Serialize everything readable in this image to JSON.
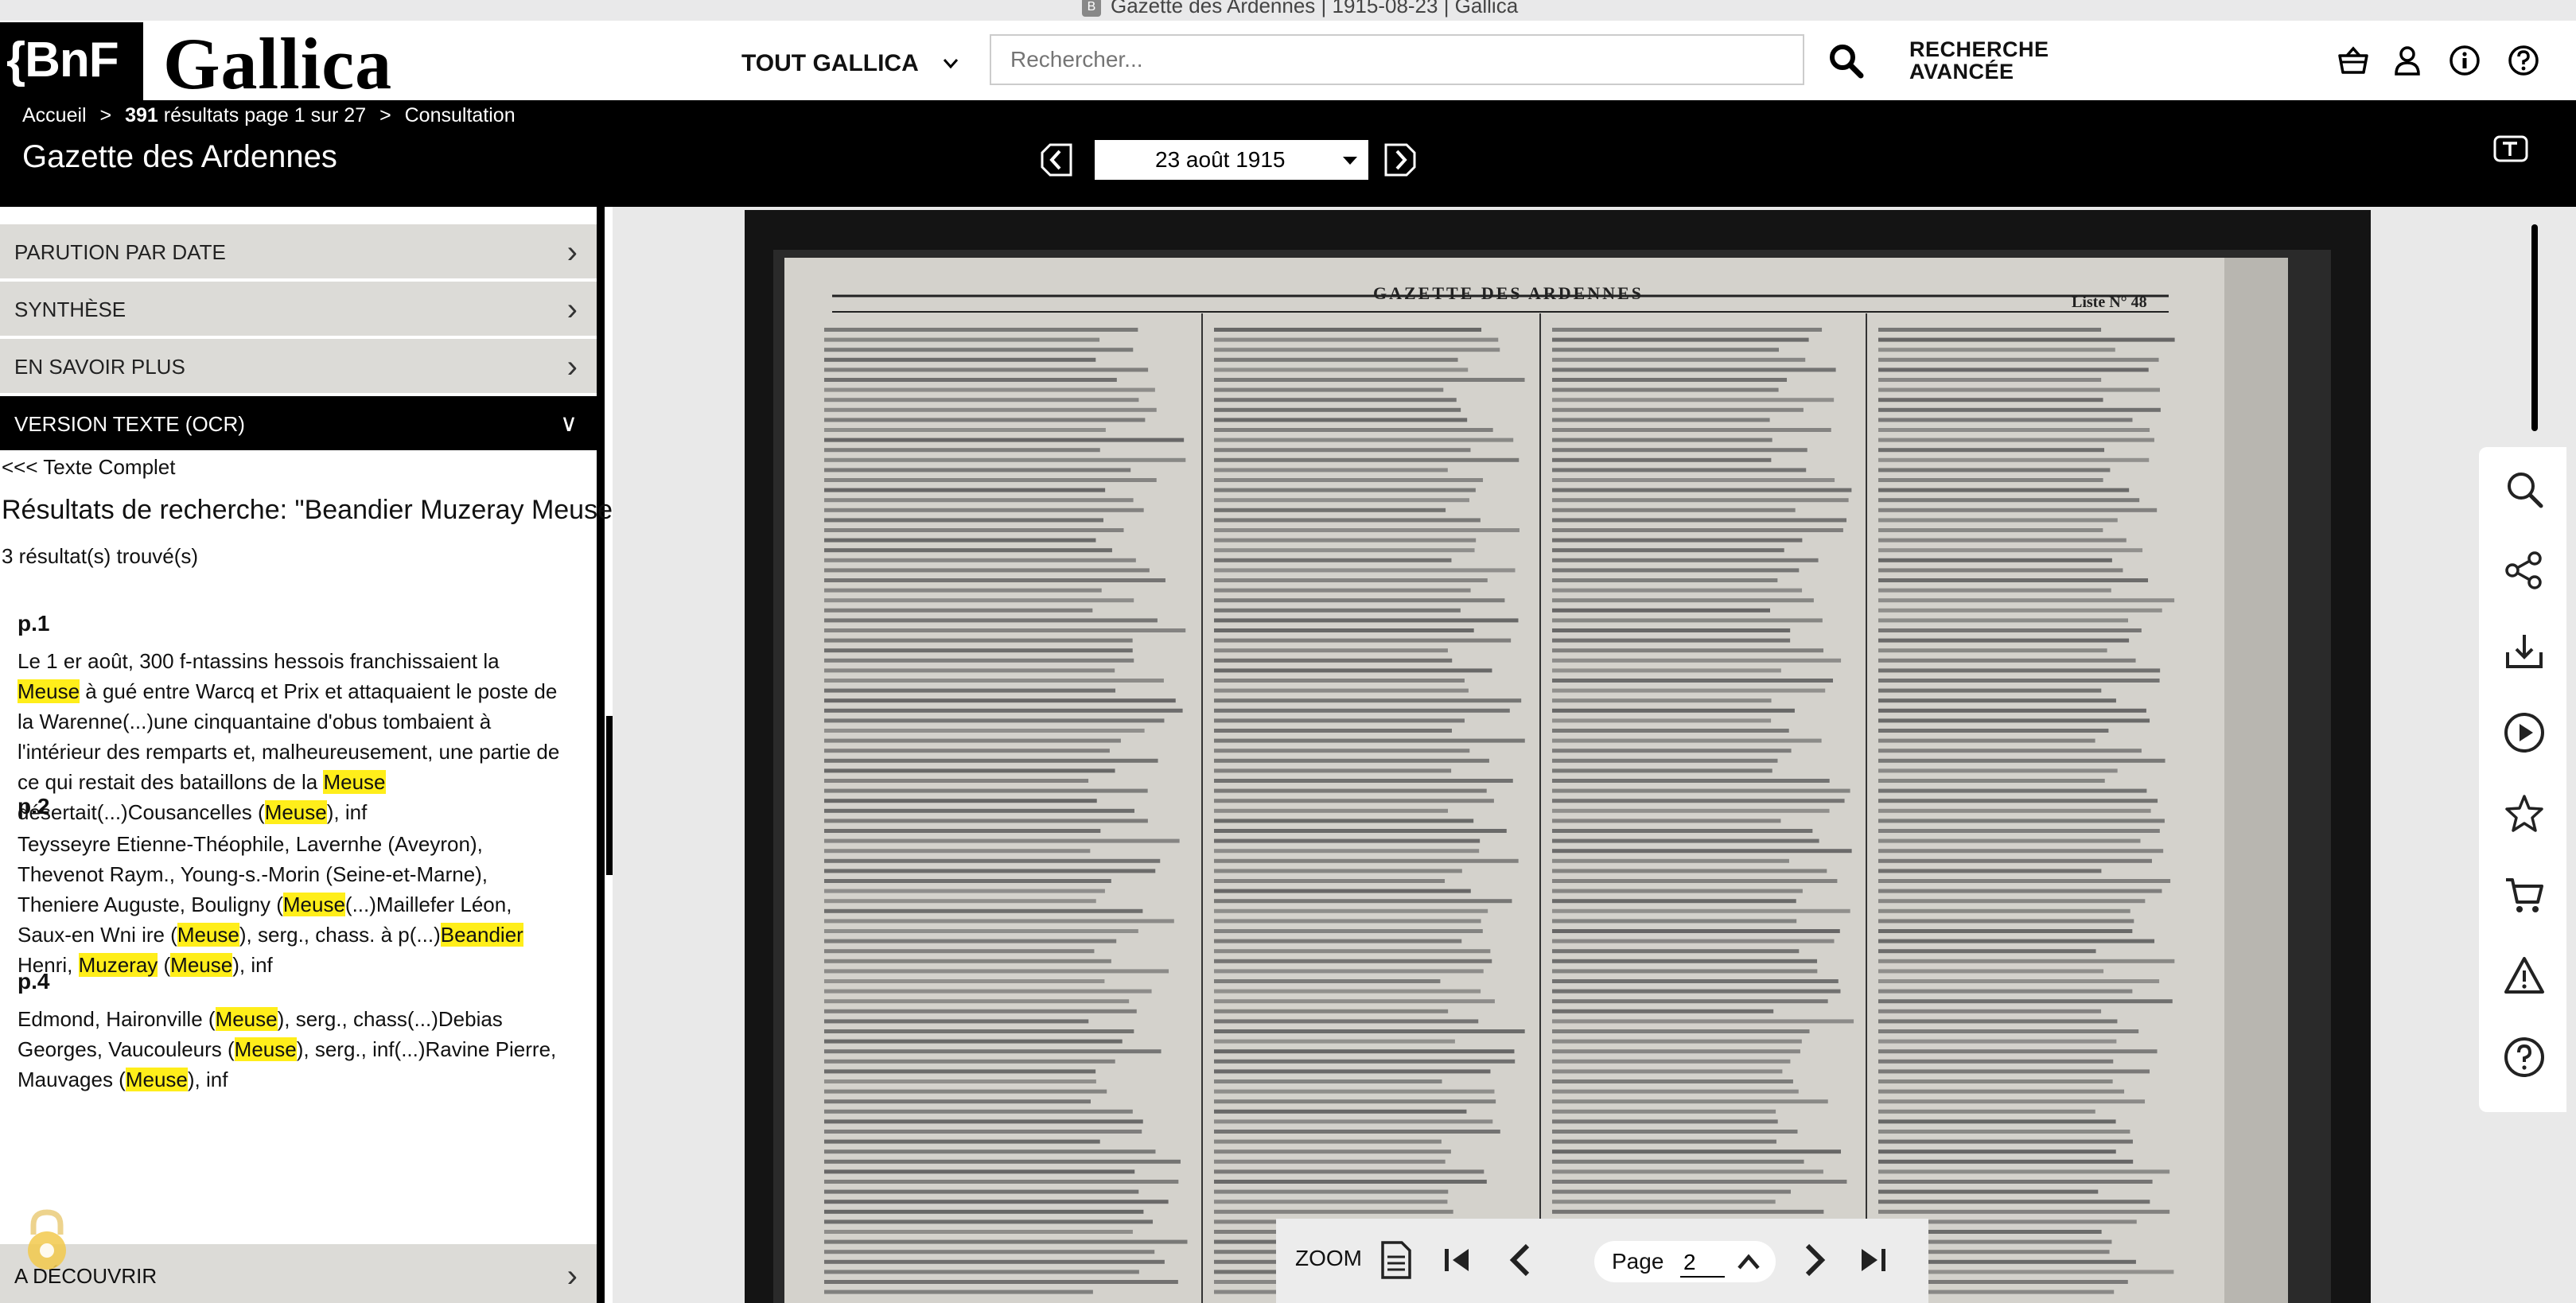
{
  "browser": {
    "tab_title": "Gazette des Ardennes | 1915-08-23 | Gallica"
  },
  "header": {
    "bnf_logo": "{BnF",
    "gallica_logo": "Gallica",
    "scope": "TOUT GALLICA",
    "search_placeholder": "Rechercher...",
    "advanced_search_line1": "RECHERCHE",
    "advanced_search_line2": "AVANCÉE"
  },
  "breadcrumb": {
    "home": "Accueil",
    "sep": ">",
    "results_count": "391",
    "results_text": "résultats page 1 sur 27",
    "current": "Consultation"
  },
  "document": {
    "title": "Gazette des Ardennes",
    "date": "23 août 1915"
  },
  "sidebar": {
    "sections": [
      {
        "label": "PARUTION PAR DATE"
      },
      {
        "label": "SYNTHÈSE"
      },
      {
        "label": "EN SAVOIR PLUS"
      },
      {
        "label": "VERSION TEXTE (OCR)"
      }
    ],
    "full_text_link": "<<< Texte Complet",
    "results_title": "Résultats de recherche: \"Beandier Muzeray Meuse\"",
    "results_count": "3 résultat(s) trouvé(s)",
    "bottom_section": "A DÉCOUVRIR",
    "results": [
      {
        "page": "p.1",
        "parts": [
          {
            "t": "Le 1 er août, 300 f-ntassins hessois franchissaient la "
          },
          {
            "t": "Meuse",
            "hl": true
          },
          {
            "t": " à gué entre Warcq et Prix et attaquaient le poste de la Warenne(...)une cinquantaine d'obus tombaient à l'intérieur des remparts et, malheureusement, une partie de ce qui restait des bataillons de la "
          },
          {
            "t": "Meuse",
            "hl": true
          },
          {
            "t": " désertait(...)Cousancelles ("
          },
          {
            "t": "Meuse",
            "hl": true
          },
          {
            "t": "), inf"
          }
        ]
      },
      {
        "page": "p.2",
        "parts": [
          {
            "t": "Teysseyre Etienne-Théophile, Lavernhe (Aveyron), Thevenot Raym., Young-s.-Morin (Seine-et-Marne), Theniere Auguste, Bouligny ("
          },
          {
            "t": "Meuse",
            "hl": true
          },
          {
            "t": "(...)Maillefer Léon, Saux-en Wni ire ("
          },
          {
            "t": "Meuse",
            "hl": true
          },
          {
            "t": "), serg., chass. à p(...)"
          },
          {
            "t": "Beandier",
            "hl": true
          },
          {
            "t": " Henri, "
          },
          {
            "t": "Muzeray",
            "hl": true
          },
          {
            "t": " ("
          },
          {
            "t": "Meuse",
            "hl": true
          },
          {
            "t": "), inf"
          }
        ]
      },
      {
        "page": "p.4",
        "parts": [
          {
            "t": "Edmond, Haironville ("
          },
          {
            "t": "Meuse",
            "hl": true
          },
          {
            "t": "), serg., chass(...)Debias Georges, Vaucouleurs ("
          },
          {
            "t": "Meuse",
            "hl": true
          },
          {
            "t": "), serg., inf(...)Ravine Pierre, Mauvages ("
          },
          {
            "t": "Meuse",
            "hl": true
          },
          {
            "t": "), inf"
          }
        ]
      }
    ]
  },
  "scan": {
    "masthead": "GAZETTE DES ARDENNES",
    "list_label": "Liste N° 48"
  },
  "viewer_toolbar": {
    "zoom_label": "ZOOM",
    "page_label": "Page",
    "page_number": "2"
  }
}
